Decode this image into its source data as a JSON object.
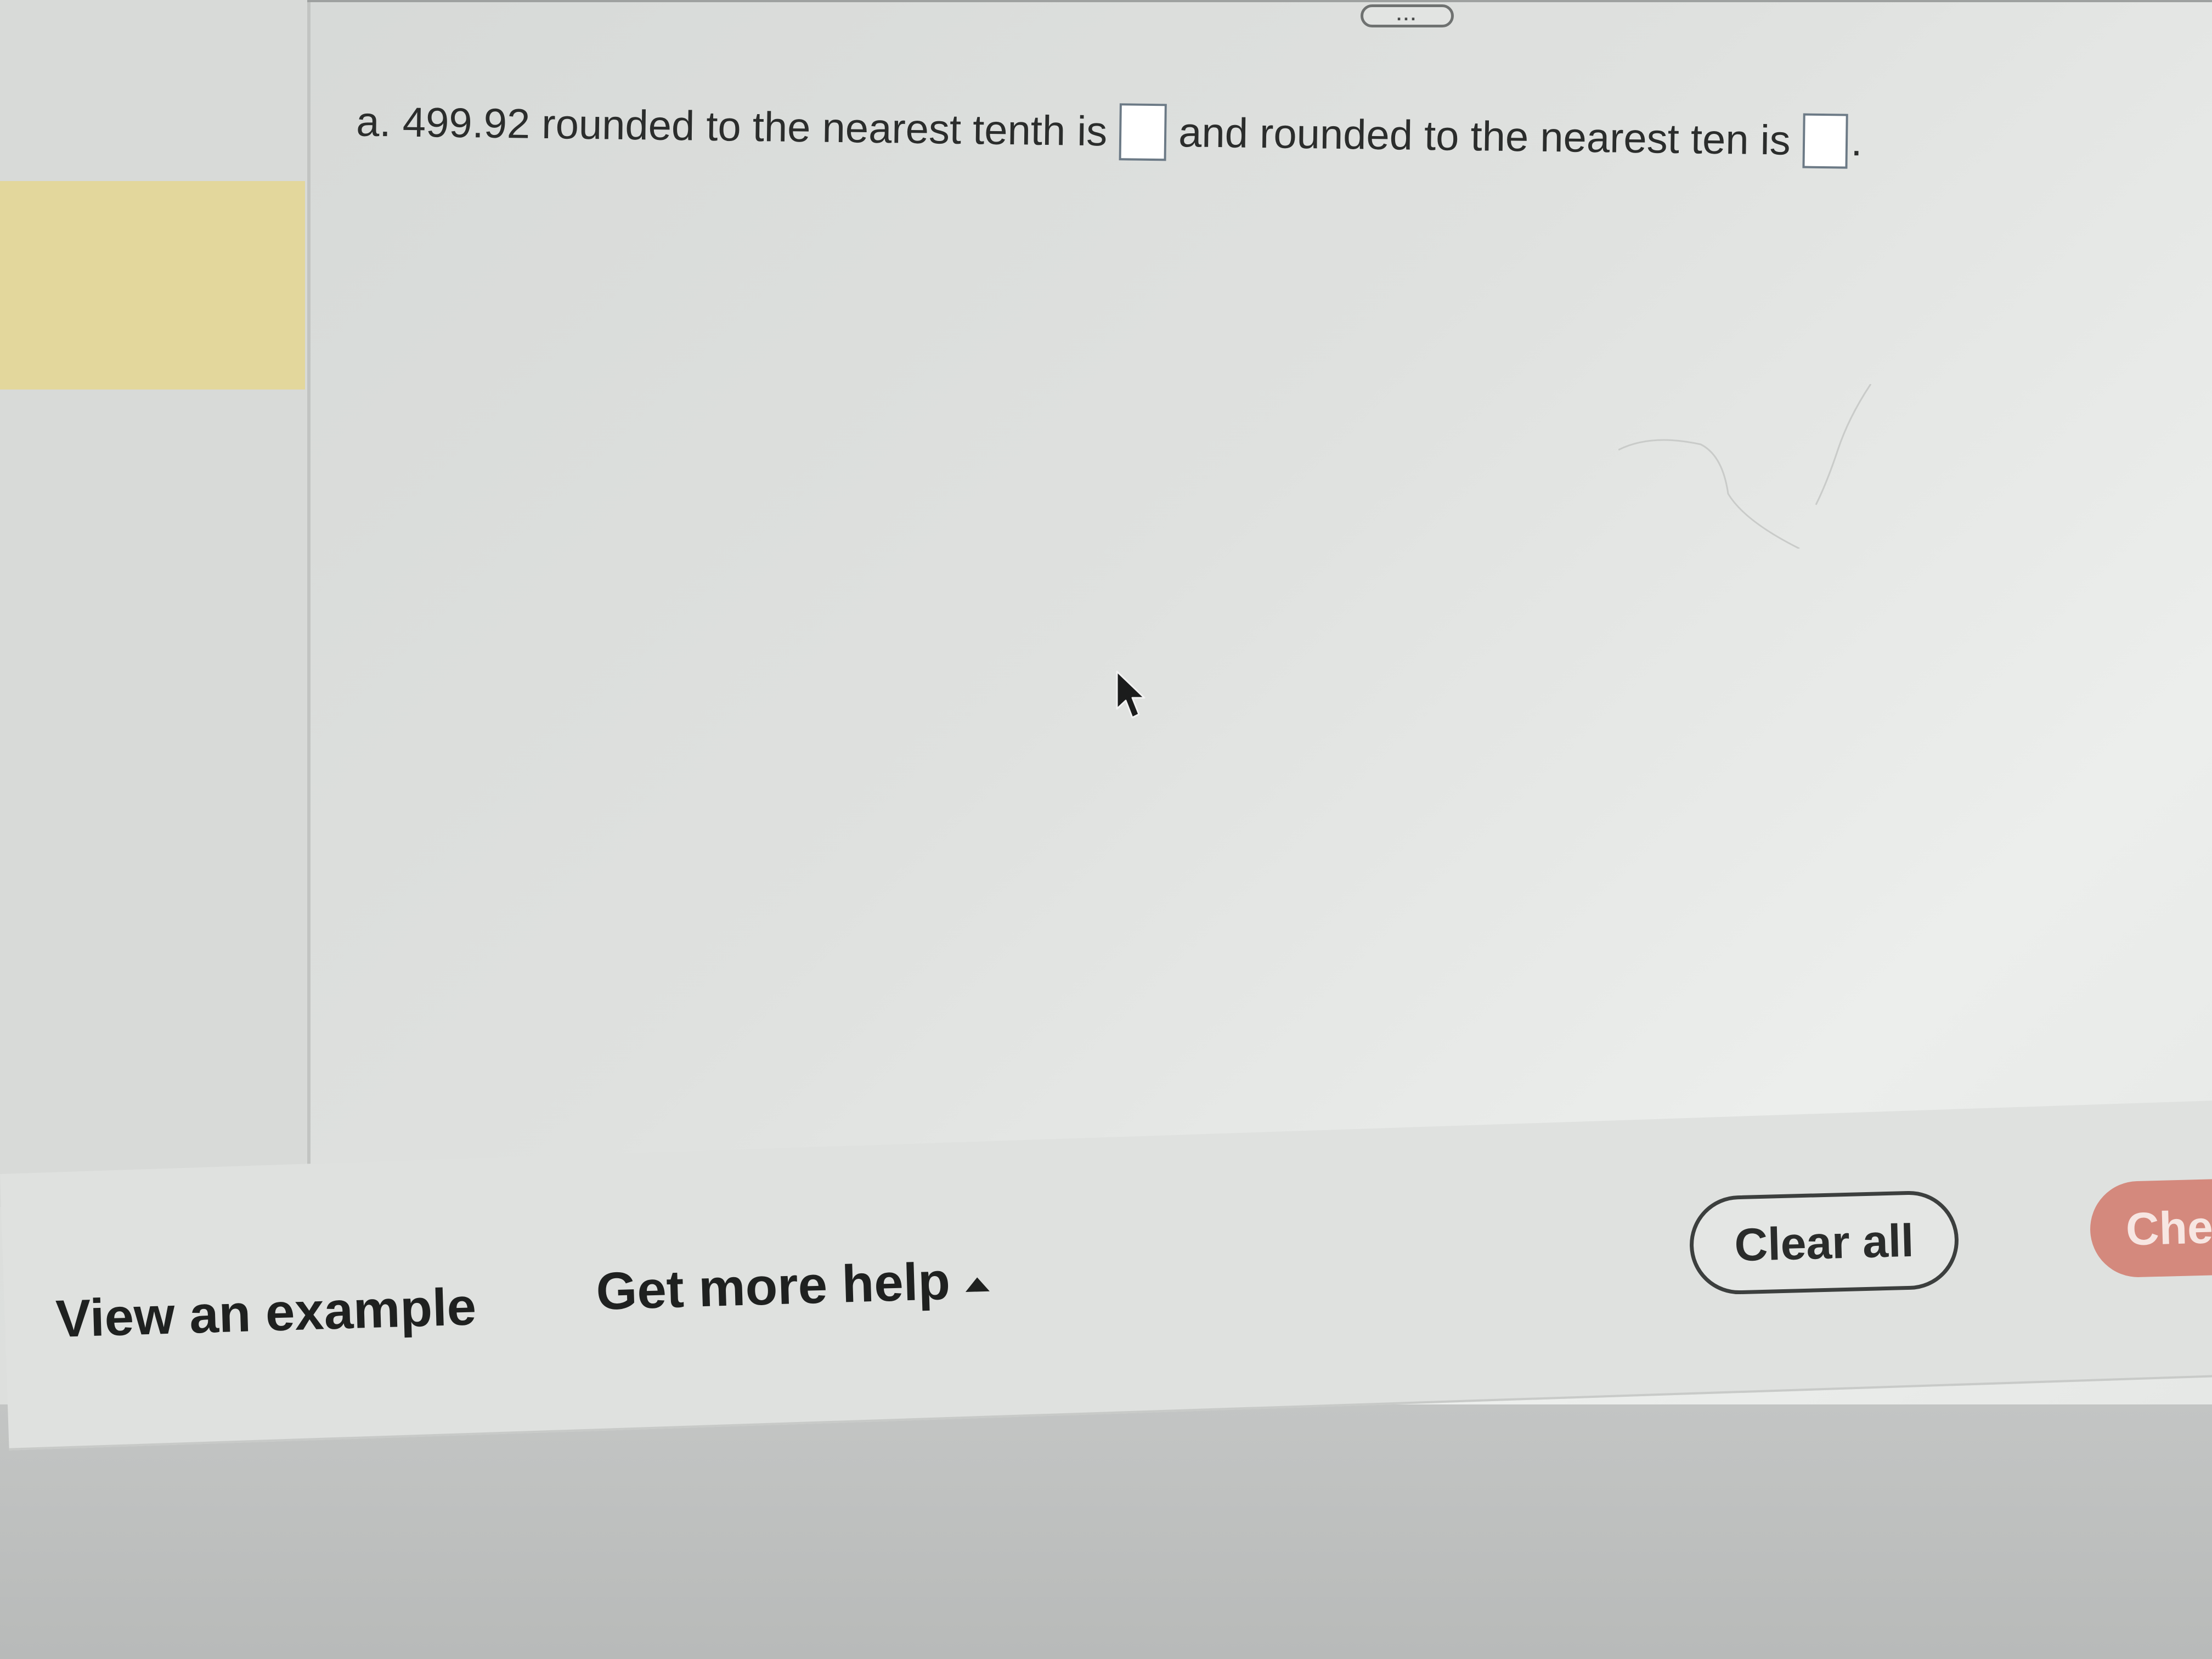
{
  "toolbar": {
    "more_label": "..."
  },
  "question": {
    "part_label": "a.",
    "text_before": "499.92 rounded to the nearest tenth is",
    "text_middle": "and rounded to the nearest ten is",
    "text_after": ".",
    "answer_tenth": "",
    "answer_ten": ""
  },
  "footer": {
    "view_example_label": "View an example",
    "get_more_help_label": "Get more help",
    "clear_all_label": "Clear all",
    "check_answer_label": "Che"
  },
  "colors": {
    "sidebar_highlight": "#e3d79c",
    "check_button": "#d4897d",
    "text": "#2b2d2c"
  },
  "icons": {
    "help_toggle": "caret-up-icon",
    "pointer": "mouse-cursor-icon"
  }
}
